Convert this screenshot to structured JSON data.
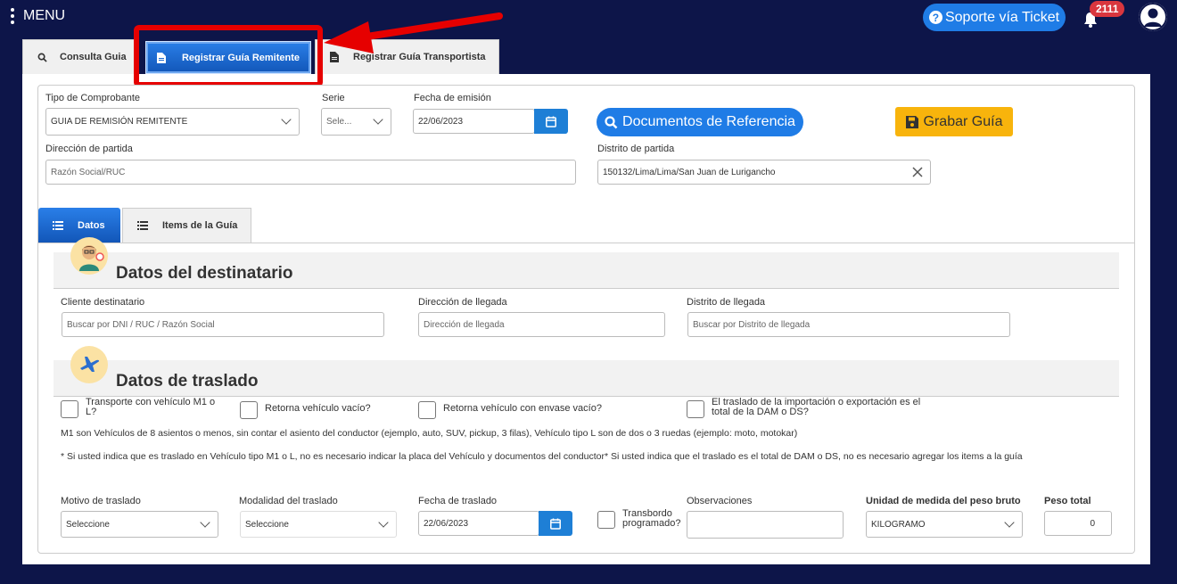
{
  "header": {
    "menu_label": "MENU",
    "support_label": "Soporte vía Ticket",
    "notif_count": "2111"
  },
  "top_tabs": {
    "consulta": "Consulta Guia",
    "registrar_remitente": "Registrar Guía Remitente",
    "registrar_transportista": "Registrar Guía Transportista",
    "active": "registrar_remitente"
  },
  "form": {
    "tipo_label": "Tipo de Comprobante",
    "tipo_value": "GUIA DE REMISIÓN REMITENTE",
    "serie_label": "Serie",
    "serie_value": "Sele...",
    "fecha_emision_label": "Fecha de emisión",
    "fecha_emision_value": "22/06/2023",
    "doc_ref_label": "Documentos de Referencia",
    "save_label": "Grabar Guía",
    "dir_partida_label": "Dirección de partida",
    "dir_partida_placeholder": "Razón Social/RUC",
    "distrito_partida_label": "Distrito de partida",
    "distrito_partida_value": "150132/Lima/Lima/San Juan de Lurigancho"
  },
  "sub_tabs": {
    "datos": "Datos",
    "items": "Items de la Guía",
    "active": "datos"
  },
  "destinatario": {
    "title": "Datos del destinatario",
    "cliente_label": "Cliente destinatario",
    "cliente_placeholder": "Buscar por DNI / RUC / Razón Social",
    "dir_llegada_label": "Dirección de llegada",
    "dir_llegada_placeholder": "Dirección de llegada",
    "distrito_llegada_label": "Distrito de llegada",
    "distrito_llegada_placeholder": "Buscar por Distrito de llegada"
  },
  "traslado": {
    "title": "Datos de traslado",
    "chk_m1_line1": "Transporte con vehículo M1 o",
    "chk_m1_line2": "L?",
    "chk_retorna_vacio": "Retorna vehículo vacío?",
    "chk_retorna_envase": "Retorna vehículo con envase vacío?",
    "chk_importacion_line1": "El traslado de la importación o exportación es el",
    "chk_importacion_line2": "total de la DAM o DS?",
    "note_m1": "M1 son Vehículos de 8 asientos o menos, sin contar el asiento del conductor (ejemplo, auto, SUV, pickup, 3 filas), Vehículo tipo L son de dos o 3 ruedas (ejemplo: moto, motokar)",
    "note_info": "* Si usted indica que es traslado en Vehículo tipo M1 o L, no es necesario indicar la placa del Vehículo y documentos del conductor* Si usted indica que el traslado es el total de DAM o DS, no es necesario agregar los items a la guía",
    "motivo_label": "Motivo de traslado",
    "motivo_value": "Seleccione",
    "modalidad_label": "Modalidad del traslado",
    "modalidad_value": "Seleccione",
    "fecha_traslado_label": "Fecha de traslado",
    "fecha_traslado_value": "22/06/2023",
    "transbordo_line1": "Transbordo",
    "transbordo_line2": "programado?",
    "observaciones_label": "Observaciones",
    "unidad_label": "Unidad de medida del peso bruto",
    "unidad_value": "KILOGRAMO",
    "peso_label": "Peso total",
    "peso_value": "0"
  },
  "colors": {
    "background": "#0d1549",
    "primary": "#1f7ce6",
    "save": "#f8b40c",
    "highlight": "#e60000"
  }
}
